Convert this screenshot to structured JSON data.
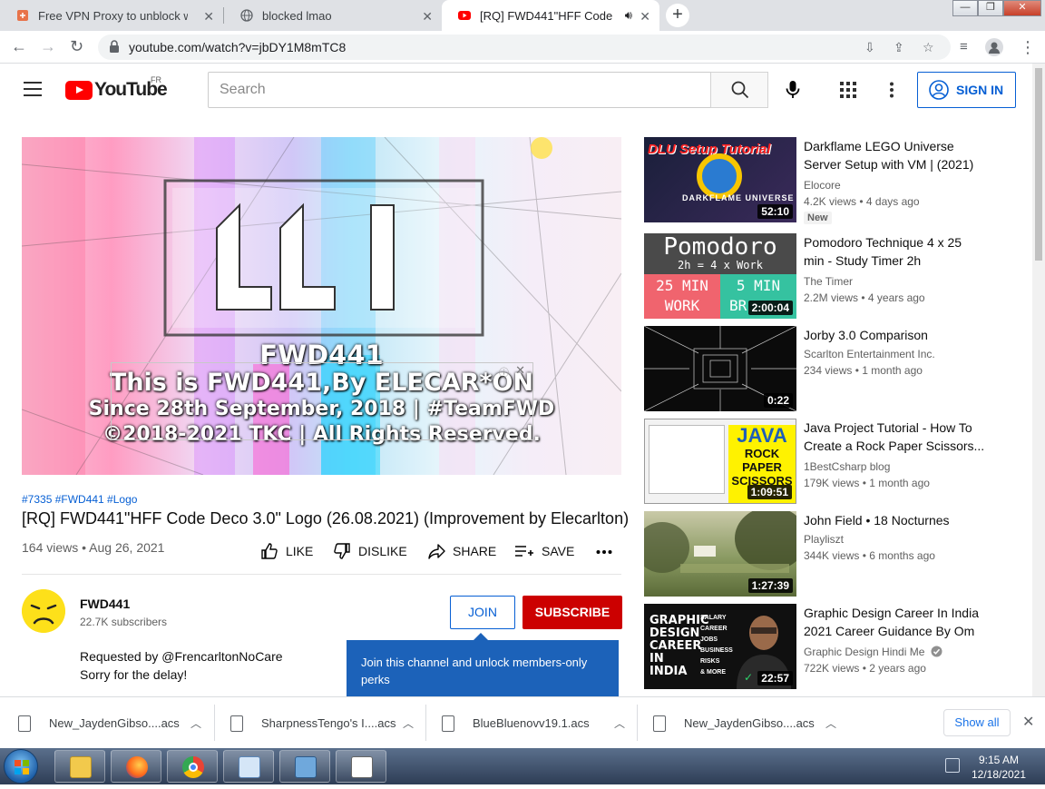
{
  "browser": {
    "tabs": [
      {
        "title": "Free VPN Proxy to unblock webs",
        "icon": "shield-favicon"
      },
      {
        "title": "blocked lmao",
        "icon": "globe-favicon"
      },
      {
        "title": "[RQ] FWD441\"HFF Code Dec",
        "icon": "youtube-favicon",
        "active": true
      }
    ],
    "url": "youtube.com/watch?v=jbDY1M8mTC8"
  },
  "youtube": {
    "logo_text": "YouTube",
    "country_code": "FR",
    "search_placeholder": "Search",
    "sign_in": "SIGN IN",
    "video": {
      "overlay_name": "FWD441",
      "overlay_line1": "This is FWD441,By ELECAR*ON",
      "overlay_line2": "Since 28th September, 2018 | #TeamFWD",
      "overlay_line3": "©2018-2021 TKC | All Rights Reserved.",
      "tags": "#7335 #FWD441 #Logo",
      "title": "[RQ] FWD441\"HFF Code Deco 3.0\" Logo (26.08.2021) (Improvement by Elecarlton)",
      "meta": "164 views • Aug 26, 2021",
      "actions": {
        "like": "LIKE",
        "dislike": "DISLIKE",
        "share": "SHARE",
        "save": "SAVE"
      },
      "channel": {
        "name": "FWD441",
        "subscribers": "22.7K subscribers"
      },
      "description": [
        "Requested by @FrencarltonNoCare",
        "Sorry for the delay!"
      ],
      "join": "JOIN",
      "subscribe": "SUBSCRIBE",
      "join_tooltip": "Join this channel and unlock members-only perks"
    },
    "recommendations": [
      {
        "title": "Darkflame LEGO Universe Server Setup with VM | (2021)",
        "channel": "Elocore",
        "stats": "4.2K views • 4 days ago",
        "duration": "52:10",
        "badge": "New",
        "thumb_text": "DLU Setup Tutorial",
        "thumb_sub": "DARKFLAME UNIVERSE"
      },
      {
        "title": "Pomodoro Technique 4 x 25 min - Study Timer 2h",
        "channel": "The Timer",
        "stats": "2.2M views • 4 years ago",
        "duration": "2:00:04",
        "thumb_text": "Pomodoro",
        "thumb_sub": "2h = 4 x Work",
        "thumb_left": "25 MIN",
        "thumb_left2": "WORK",
        "thumb_right": "5 MIN",
        "thumb_right2": "BR"
      },
      {
        "title": "Jorby 3.0 Comparison",
        "channel": "Scarlton Entertainment Inc.",
        "stats": "234 views • 1 month ago",
        "duration": "0:22"
      },
      {
        "title": "Java Project Tutorial - How To Create a Rock Paper Scissors...",
        "channel": "1BestCsharp blog",
        "stats": "179K views • 1 month ago",
        "duration": "1:09:51",
        "thumb_text": "JAVA",
        "thumb_sub": "ROCK PAPER SCISSORS"
      },
      {
        "title": "John Field • 18 Nocturnes",
        "channel": "Playliszt",
        "stats": "344K views • 6 months ago",
        "duration": "1:27:39"
      },
      {
        "title": "Graphic Design Career In India 2021 Career Guidance By Om",
        "channel": "Graphic Design Hindi Me",
        "stats": "722K views • 2 years ago",
        "duration": "22:57",
        "verified": true,
        "thumb_text": "GRAPHIC DESIGN CAREER IN INDIA",
        "thumb_list": [
          "SALARY",
          "CAREER",
          "JOBS",
          "BUSINESS",
          "RISKS",
          "& MORE"
        ]
      }
    ]
  },
  "downloads": {
    "items": [
      "New_JaydenGibso....acs",
      "SharpnessTengo's I....acs",
      "BlueBluenovv19.1.acs",
      "New_JaydenGibso....acs"
    ],
    "show_all": "Show all"
  },
  "taskbar": {
    "time": "9:15 AM",
    "date": "12/18/2021",
    "apps": [
      "explorer",
      "firefox",
      "chrome",
      "control-panel",
      "remote-desktop",
      "notepad"
    ]
  },
  "colors": {
    "yt_red": "#ff0000",
    "subscribe_red": "#cc0000",
    "link_blue": "#065fd4",
    "tooltip_blue": "#1c62b9"
  }
}
